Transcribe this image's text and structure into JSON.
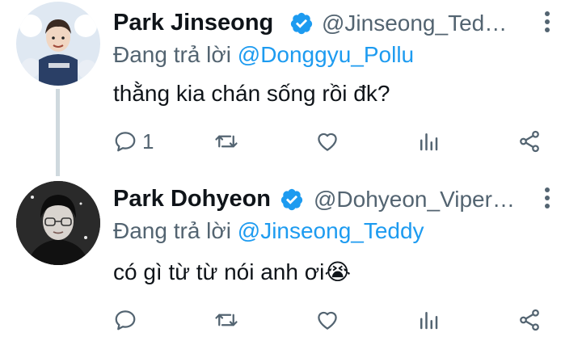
{
  "colors": {
    "text": "#0f1419",
    "secondary": "#536471",
    "accent": "#1d9bf0",
    "thread_line": "#cfd9de",
    "verified": "#1d9bf0"
  },
  "tweets": [
    {
      "name": "Park Jinseong",
      "handle": "@Jinseong_Ted…",
      "verified_icon": "verified-badge-icon",
      "reply_prefix": "Đang trả lời ",
      "reply_to": "@Donggyu_Pollu",
      "text": "thằng kia chán sống rồi đk?",
      "reply_count": "1",
      "icons": [
        "reply-icon",
        "retweet-icon",
        "like-icon",
        "analytics-icon",
        "share-icon",
        "more-vertical-icon"
      ]
    },
    {
      "name": "Park Dohyeon",
      "handle": "@Dohyeon_Viper…",
      "verified_icon": "verified-badge-icon",
      "reply_prefix": "Đang trả lời ",
      "reply_to": "@Jinseong_Teddy",
      "text": "có gì từ từ nói anh ơi",
      "emoji": "😭",
      "reply_count": "",
      "icons": [
        "reply-icon",
        "retweet-icon",
        "like-icon",
        "analytics-icon",
        "share-icon",
        "more-vertical-icon"
      ]
    }
  ]
}
